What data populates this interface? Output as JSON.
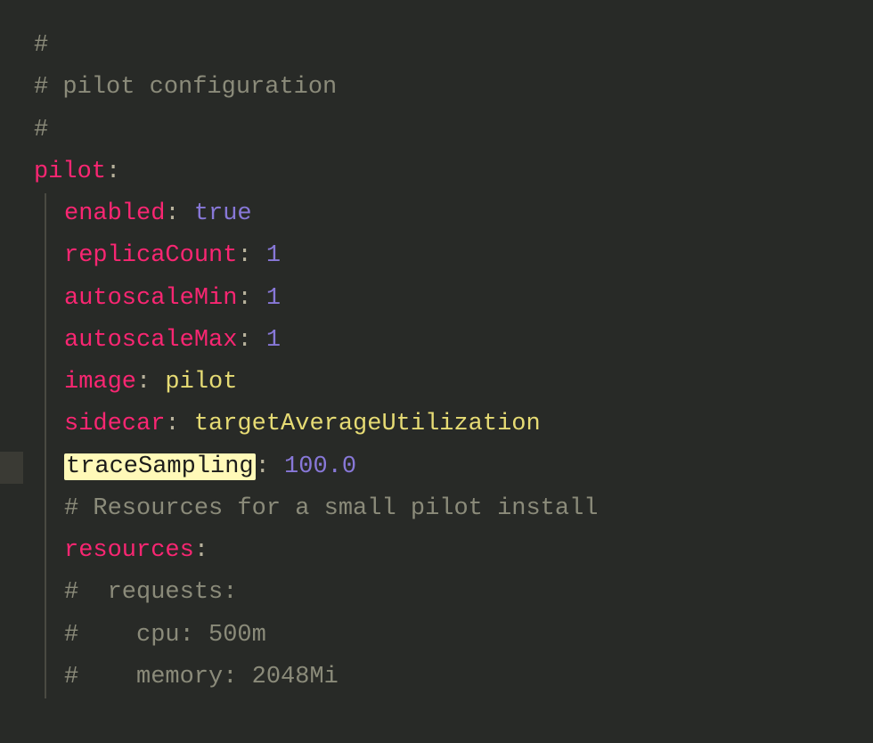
{
  "code": {
    "comment_hash": "#",
    "comment_title": "# pilot configuration",
    "root_key": "pilot",
    "colon": ":",
    "entries": {
      "enabled": {
        "key": "enabled",
        "value": "true"
      },
      "replicaCount": {
        "key": "replicaCount",
        "value": "1"
      },
      "autoscaleMin": {
        "key": "autoscaleMin",
        "value": "1"
      },
      "autoscaleMax": {
        "key": "autoscaleMax",
        "value": "1"
      },
      "image": {
        "key": "image",
        "value": "pilot"
      },
      "sidecar": {
        "key": "sidecar",
        "value": "targetAverageUtilization"
      },
      "traceSampling": {
        "key": "traceSampling",
        "value": "100.0"
      },
      "resources": {
        "key": "resources"
      }
    },
    "comment_resources": "# Resources for a small pilot install",
    "comment_requests": "#  requests:",
    "comment_cpu": "#    cpu: 500m",
    "comment_memory": "#    memory: 2048Mi"
  }
}
